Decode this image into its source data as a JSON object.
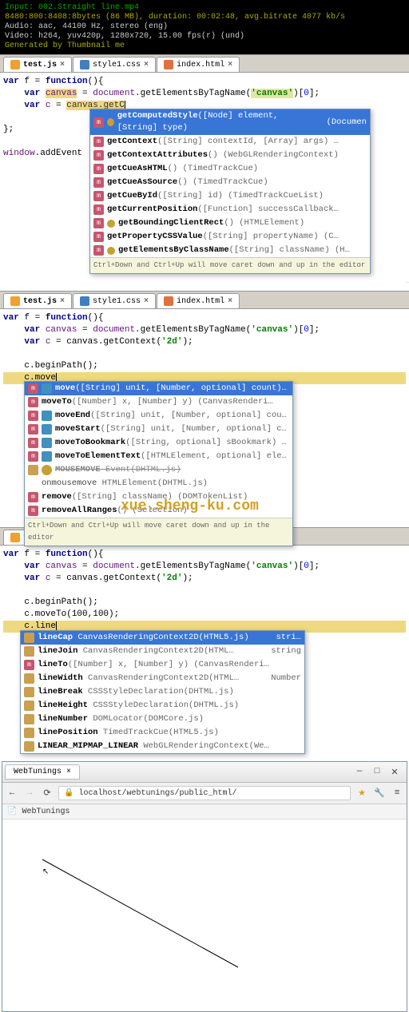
{
  "terminal": {
    "line1": "Input: 002.Straight line.mp4",
    "line2": "8480:800:8408:8bytes (86 MB), duration: 00:02:48, avg.bitrate 4077 kb/s",
    "line3": "Audio: aac, 44100 Hz, stereo (eng)",
    "line4": "Video: h264, yuv420p, 1280x720, 15.00 fps(r) (und)",
    "line5": "Generated by Thumbnail me"
  },
  "tabs": {
    "test": "test.js",
    "style": "style1.css",
    "index": "index.html"
  },
  "code1": {
    "l1_a": "var",
    "l1_b": " f = ",
    "l1_c": "function",
    "l1_d": "(){",
    "l2_a": "    var ",
    "l2_b": "canvas",
    "l2_c": " = ",
    "l2_d": "document",
    "l2_e": ".getElementsByTagName(",
    "l2_f": "'canvas'",
    "l2_g": ")[",
    "l2_h": "0",
    "l2_i": "];",
    "l3_a": "    var ",
    "l3_b": "c",
    "l3_c": " = ",
    "l3_d": "canvas",
    "l3_e": ".getC",
    "l5": "};",
    "l7_a": "window",
    "l7_b": ".addEvent"
  },
  "ac1": {
    "hint": "Ctrl+Down and Ctrl+Up will move caret down and up in the editor",
    "items": [
      {
        "n": "getComputedStyle",
        "s": "([Node] element, [String] type)",
        "t": "(Documen"
      },
      {
        "n": "getContext",
        "s": "([String] contextId, [Array] args)",
        "t": "…"
      },
      {
        "n": "getContextAttributes",
        "s": "()",
        "t": "(WebGLRenderingContext)"
      },
      {
        "n": "getCueAsHTML",
        "s": "()",
        "t": "(TimedTrackCue)"
      },
      {
        "n": "getCueAsSource",
        "s": "()",
        "t": "(TimedTrackCue)"
      },
      {
        "n": "getCueById",
        "s": "([String] id)",
        "t": "(TimedTrackCueList)"
      },
      {
        "n": "getCurrentPosition",
        "s": "([Function] successCallback…",
        "t": ""
      },
      {
        "n": "getBoundingClientRect",
        "s": "()",
        "t": "(HTMLElement)"
      },
      {
        "n": "getPropertyCSSValue",
        "s": "([String] propertyName)",
        "t": "(C…"
      },
      {
        "n": "getElementsByClassName",
        "s": "([String] className)",
        "t": "(H…"
      }
    ]
  },
  "code2": {
    "l3_a": "    var ",
    "l3_b": "c",
    "l3_c": " = canvas.getContext(",
    "l3_d": "'2d'",
    "l3_e": ");",
    "l5_a": "    c.beginPath();",
    "l6_a": "    c.move"
  },
  "ac2": {
    "hint": "Ctrl+Down and Ctrl+Up will move caret down and up in the editor",
    "items": [
      {
        "n": "move",
        "s": "([String] unit, [Number, optional] count)…"
      },
      {
        "n": "moveTo",
        "s": "([Number] x, [Number] y) (CanvasRenderi…"
      },
      {
        "n": "moveEnd",
        "s": "([String] unit, [Number, optional] cou…"
      },
      {
        "n": "moveStart",
        "s": "([String] unit, [Number, optional] c…"
      },
      {
        "n": "moveToBookmark",
        "s": "([String, optional] sBookmark) …"
      },
      {
        "n": "moveToElementText",
        "s": "([HTMLElement, optional] ele…"
      },
      {
        "n": "MOUSEMOVE",
        "s": " Event(DHTML.js)",
        "strike": true
      },
      {
        "n": "onmousemove",
        "s": " HTMLElement(DHTML.js)"
      },
      {
        "n": "remove",
        "s": "([String] className) (DOMTokenList)"
      },
      {
        "n": "removeAllRanges",
        "s": "() (Selection)",
        "wm": true
      }
    ]
  },
  "watermark": "xue.sheng-ku.com",
  "code3": {
    "l5": "    c.beginPath();",
    "l6": "    c.moveTo(100,100);",
    "l7": "    c.line"
  },
  "ac3": {
    "items": [
      {
        "n": "lineCap",
        "s": " CanvasRenderingContext2D(HTML5.js)",
        "t": "stri…"
      },
      {
        "n": "lineJoin",
        "s": " CanvasRenderingContext2D(HTML…",
        "t": "string"
      },
      {
        "n": "lineTo",
        "s": "([Number] x, [Number] y) (CanvasRenderi…"
      },
      {
        "n": "lineWidth",
        "s": " CanvasRenderingContext2D(HTML…",
        "t": "Number"
      },
      {
        "n": "lineBreak",
        "s": " CSSStyleDeclaration(DHTML.js)"
      },
      {
        "n": "lineHeight",
        "s": " CSSStyleDeclaration(DHTML.js)"
      },
      {
        "n": "lineNumber",
        "s": " DOMLocator(DOMCore.js)"
      },
      {
        "n": "linePosition",
        "s": " TimedTrackCue(HTML5.js)"
      },
      {
        "n": "LINEAR_MIPMAP_LINEAR",
        "s": " WebGLRenderingContext(We…"
      }
    ]
  },
  "browser": {
    "tab": "WebTunings",
    "url": "localhost/webtunings/public_html/",
    "bookbar": "WebTunings"
  }
}
